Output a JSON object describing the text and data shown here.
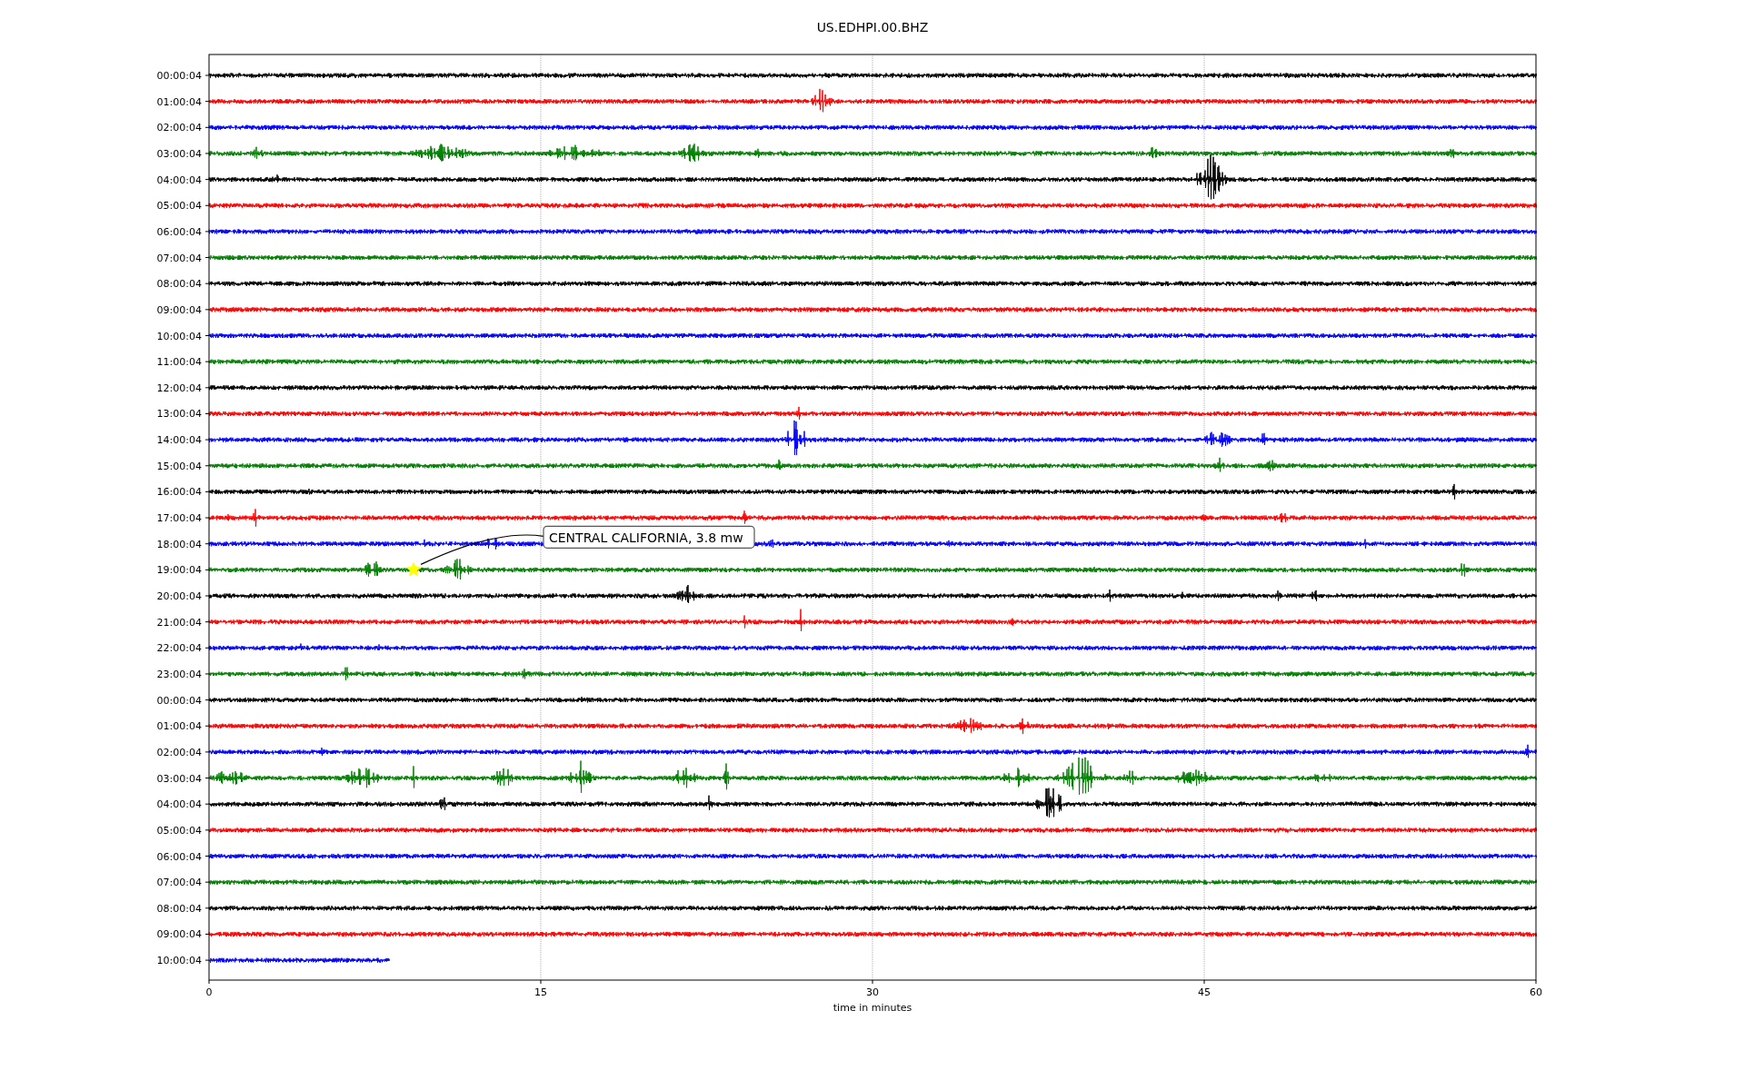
{
  "plot": {
    "title": "US.EDHPI.00.BHZ",
    "xlabel": "time in minutes",
    "xticks": [
      "0",
      "15",
      "30",
      "45",
      "60"
    ],
    "rows": [
      {
        "label": "00:00:04",
        "color": "#000000",
        "level": 1
      },
      {
        "label": "01:00:04",
        "color": "#ff0000",
        "level": 1
      },
      {
        "label": "02:00:04",
        "color": "#0000ff",
        "level": 1
      },
      {
        "label": "03:00:04",
        "color": "#008000",
        "level": 1
      },
      {
        "label": "04:00:04",
        "color": "#000000",
        "level": 1
      },
      {
        "label": "05:00:04",
        "color": "#ff0000",
        "level": 1
      },
      {
        "label": "06:00:04",
        "color": "#0000ff",
        "level": 1
      },
      {
        "label": "07:00:04",
        "color": "#008000",
        "level": 1
      },
      {
        "label": "08:00:04",
        "color": "#000000",
        "level": 1
      },
      {
        "label": "09:00:04",
        "color": "#ff0000",
        "level": 1
      },
      {
        "label": "10:00:04",
        "color": "#0000ff",
        "level": 1
      },
      {
        "label": "11:00:04",
        "color": "#008000",
        "level": 1
      },
      {
        "label": "12:00:04",
        "color": "#000000",
        "level": 1
      },
      {
        "label": "13:00:04",
        "color": "#ff0000",
        "level": 1
      },
      {
        "label": "14:00:04",
        "color": "#0000ff",
        "level": 1
      },
      {
        "label": "15:00:04",
        "color": "#008000",
        "level": 1
      },
      {
        "label": "16:00:04",
        "color": "#000000",
        "level": 1
      },
      {
        "label": "17:00:04",
        "color": "#ff0000",
        "level": 1
      },
      {
        "label": "18:00:04",
        "color": "#0000ff",
        "level": 1
      },
      {
        "label": "19:00:04",
        "color": "#008000",
        "level": 1
      },
      {
        "label": "20:00:04",
        "color": "#000000",
        "level": 1
      },
      {
        "label": "21:00:04",
        "color": "#ff0000",
        "level": 1
      },
      {
        "label": "22:00:04",
        "color": "#0000ff",
        "level": 1
      },
      {
        "label": "23:00:04",
        "color": "#008000",
        "level": 1
      },
      {
        "label": "00:00:04",
        "color": "#000000",
        "level": 1
      },
      {
        "label": "01:00:04",
        "color": "#ff0000",
        "level": 1
      },
      {
        "label": "02:00:04",
        "color": "#0000ff",
        "level": 1
      },
      {
        "label": "03:00:04",
        "color": "#008000",
        "level": 1
      },
      {
        "label": "04:00:04",
        "color": "#000000",
        "level": 1
      },
      {
        "label": "05:00:04",
        "color": "#ff0000",
        "level": 1
      },
      {
        "label": "06:00:04",
        "color": "#0000ff",
        "level": 1
      },
      {
        "label": "07:00:04",
        "color": "#008000",
        "level": 1
      },
      {
        "label": "08:00:04",
        "color": "#000000",
        "level": 1
      },
      {
        "label": "09:00:04",
        "color": "#ff0000",
        "level": 1
      },
      {
        "label": "10:00:04",
        "color": "#0000ff",
        "level": 0.136
      }
    ],
    "annotation": {
      "text": "CENTRAL CALIFORNIA, 3.8 mw"
    }
  }
}
